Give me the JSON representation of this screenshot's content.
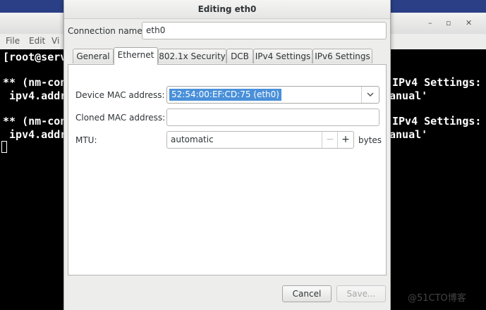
{
  "background_window": {
    "menu": [
      "File",
      "Edit",
      "Vi"
    ],
    "controls": [
      "–",
      "▫",
      "✕"
    ],
    "terminal_left": [
      "[root@serv",
      "** (nm-con",
      " ipv4.addr",
      "** (nm-con",
      " ipv4.addr"
    ],
    "terminal_right": [
      "IPv4 Settings:",
      "anual'",
      "IPv4 Settings:",
      "anual'"
    ]
  },
  "dialog": {
    "title": "Editing eth0",
    "connection_name_label": "Connection name:",
    "connection_name_value": "eth0",
    "tabs": [
      {
        "label": "General"
      },
      {
        "label": "Ethernet"
      },
      {
        "label": "802.1x Security"
      },
      {
        "label": "DCB"
      },
      {
        "label": "IPv4 Settings"
      },
      {
        "label": "IPv6 Settings"
      }
    ],
    "active_tab": "Ethernet",
    "device_mac_label": "Device MAC address:",
    "device_mac_value": "52:54:00:EF:CD:75 (eth0)",
    "cloned_mac_label": "Cloned MAC address:",
    "cloned_mac_value": "",
    "mtu_label": "MTU:",
    "mtu_value": "automatic",
    "mtu_minus": "−",
    "mtu_plus": "+",
    "mtu_unit": "bytes",
    "cancel_label": "Cancel",
    "save_label": "Save..."
  },
  "watermark": "@51CTO博客",
  "colors": {
    "selection": "#4a90d9",
    "terminal_bg": "#000000",
    "desktop": "#2a3f86"
  }
}
